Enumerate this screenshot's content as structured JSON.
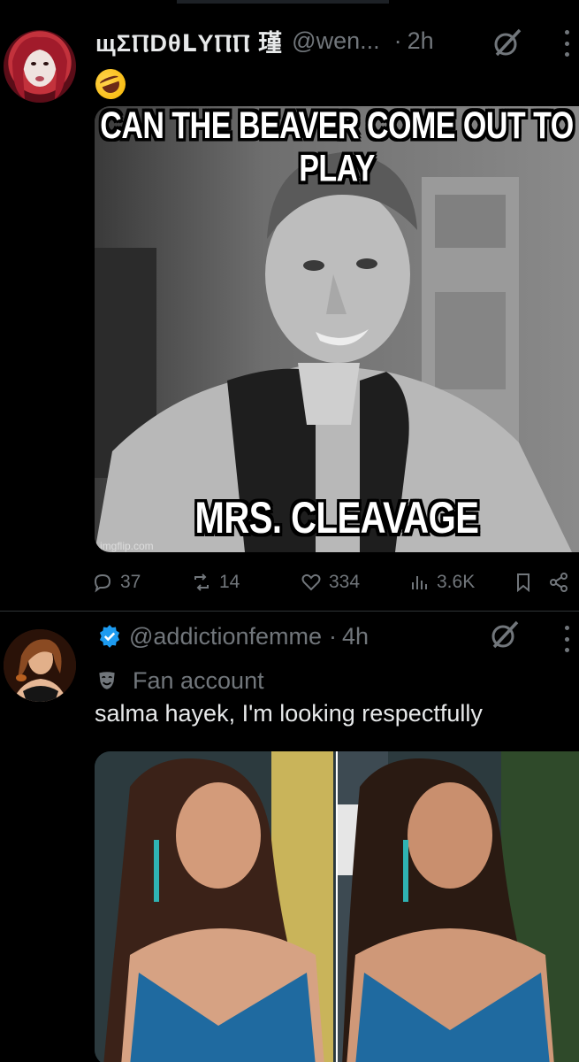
{
  "tweets": [
    {
      "author": {
        "display_name": "щΣⲠDθᒪYⲠⲠ 瑾",
        "handle": "@wen...",
        "time": "2h"
      },
      "emoji": "🤣",
      "media": {
        "top_caption": "CAN THE BEAVER COME OUT TO PLAY",
        "bottom_caption": "MRS. CLEAVAGE",
        "watermark": "imgflip.com"
      },
      "actions": {
        "replies": "37",
        "reposts": "14",
        "likes": "334",
        "views": "3.6K"
      }
    },
    {
      "author": {
        "display_name": "",
        "handle": "@addictionfemme",
        "time": "4h",
        "verified": true
      },
      "label": "Fan account",
      "text": "salma hayek, I'm looking respectfully"
    }
  ],
  "icons": {
    "grok": "grok-icon",
    "more": "more-icon",
    "reply": "reply-icon",
    "repost": "repost-icon",
    "like": "heart-icon",
    "views": "views-icon",
    "bookmark": "bookmark-icon",
    "share": "share-icon",
    "verified": "verified-badge-icon",
    "mask": "theater-mask-icon"
  },
  "colors": {
    "background": "#000000",
    "text": "#e7e9ea",
    "muted": "#71767b",
    "verified": "#1d9bf0"
  }
}
